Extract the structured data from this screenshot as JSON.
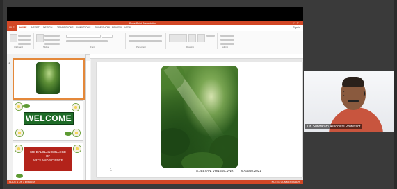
{
  "app": {
    "window_title": "PowerPoint Presentation",
    "tabs": [
      "FILE",
      "HOME",
      "INSERT",
      "DESIGN",
      "TRANSITIONS",
      "ANIMATIONS",
      "SLIDE SHOW",
      "REVIEW",
      "VIEW"
    ],
    "sign_in": "Sign in",
    "ribbon_groups": [
      "Clipboard",
      "Slides",
      "Font",
      "Paragraph",
      "Drawing",
      "Editing"
    ]
  },
  "thumbnails": {
    "slide1_num": "1",
    "slide2_title": "WELCOME",
    "slide3_lines": [
      "SRI BALOLAN COLLEGE",
      "OF",
      "ARTS AND SCIENCE"
    ]
  },
  "slide": {
    "number": "1",
    "footer": "A.JEEVAN, VHNSNC,VNR",
    "date": "6 August 2021"
  },
  "status": {
    "left": "SLIDE 1 OF 3    ENGLISH",
    "right": "NOTES  COMMENTS   83%"
  },
  "camera": {
    "participant_label": "Dr. Sundaram Associate Professor"
  },
  "colors": {
    "accent": "#d24726",
    "welcome_green": "#1e6b27",
    "college_red": "#b3231a"
  }
}
